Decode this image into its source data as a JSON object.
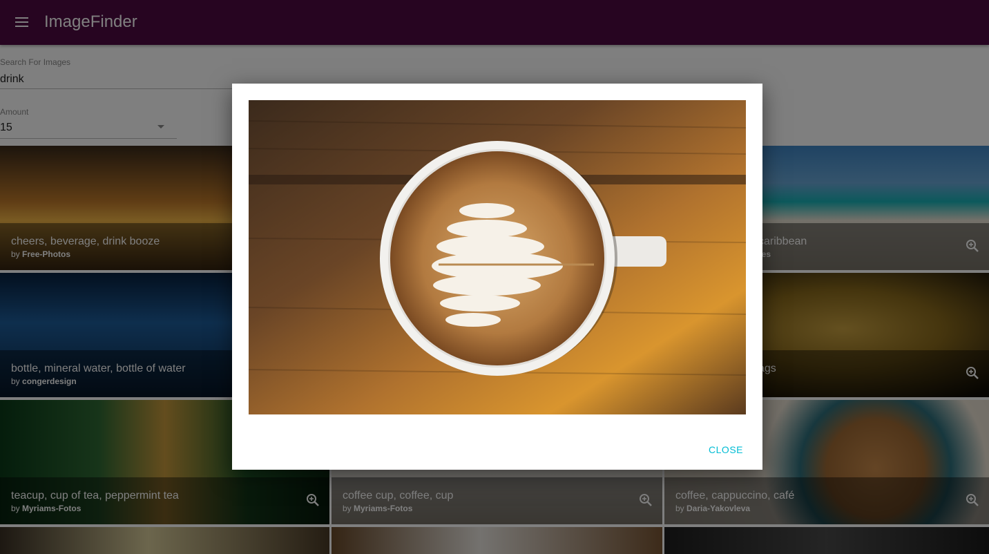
{
  "app": {
    "title": "ImageFinder"
  },
  "search": {
    "label": "Search For Images",
    "value": "drink"
  },
  "amount": {
    "label": "Amount",
    "value": "15"
  },
  "tiles": [
    {
      "title": "cheers, beverage, drink booze",
      "by_prefix": "by ",
      "author": "Free-Photos"
    },
    {
      "title": "caribbean",
      "by_prefix": "",
      "author": "res"
    },
    {
      "title": "bottle, mineral water, bottle of water",
      "by_prefix": "by ",
      "author": "congerdesign"
    },
    {
      "title": "ags",
      "by_prefix": "",
      "author": ""
    },
    {
      "title": "teacup, cup of tea, peppermint tea",
      "by_prefix": "by ",
      "author": "Myriams-Fotos"
    },
    {
      "title": "coffee cup, coffee, cup",
      "by_prefix": "by ",
      "author": "Myriams-Fotos"
    },
    {
      "title": "coffee, cappuccino, café",
      "by_prefix": "by ",
      "author": "Daria-Yakovleva"
    }
  ],
  "dialog": {
    "close_label": "CLOSE"
  },
  "colors": {
    "appbar": "#4e0a43",
    "accent": "#00bcd4"
  }
}
